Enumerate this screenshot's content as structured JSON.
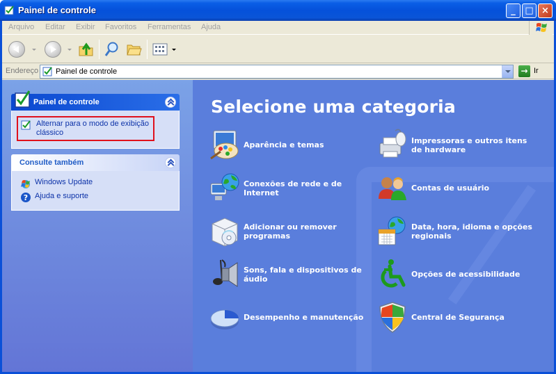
{
  "window": {
    "title": "Painel de controle"
  },
  "menu": [
    "Arquivo",
    "Editar",
    "Exibir",
    "Favoritos",
    "Ferramentas",
    "Ajuda"
  ],
  "address": {
    "label": "Endereço",
    "value": "Painel de controle",
    "go_label": "Ir"
  },
  "task_panel": {
    "title": "Painel de controle",
    "switch_link": "Alternar para o modo de exibição clássico"
  },
  "see_also": {
    "title": "Consulte também",
    "items": [
      "Windows Update",
      "Ajuda e suporte"
    ]
  },
  "main": {
    "heading": "Selecione uma categoria",
    "categories": [
      {
        "label": "Aparência e temas",
        "icon": "appearance-themes-icon"
      },
      {
        "label": "Impressoras e outros itens de hardware",
        "icon": "printer-hardware-icon"
      },
      {
        "label": "Conexões de rede e de Internet",
        "icon": "network-connections-icon"
      },
      {
        "label": "Contas de usuário",
        "icon": "user-accounts-icon"
      },
      {
        "label": "Adicionar ou remover programas",
        "icon": "add-remove-programs-icon"
      },
      {
        "label": "Data, hora, idioma e opções regionais",
        "icon": "date-time-regional-icon"
      },
      {
        "label": "Sons, fala e dispositivos de áudio",
        "icon": "sounds-audio-icon"
      },
      {
        "label": "Opções de acessibilidade",
        "icon": "accessibility-icon"
      },
      {
        "label": "Desempenho e manutenção",
        "icon": "performance-maintenance-icon"
      },
      {
        "label": "Central de Segurança",
        "icon": "security-center-icon"
      }
    ]
  },
  "colors": {
    "title_bar": "#0a55d8",
    "content_bg": "#5a7edc",
    "link": "#0c32a8",
    "highlight_border": "#e0101c"
  }
}
